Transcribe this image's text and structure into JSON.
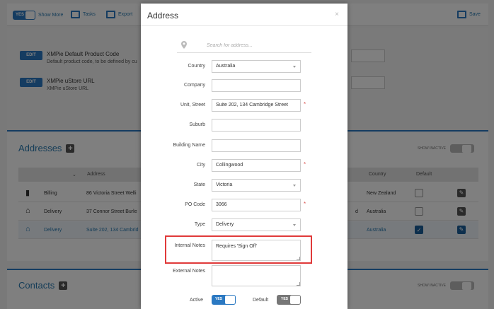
{
  "background": {
    "toolbar": {
      "show_more_toggle": "YES",
      "show_more_label": "Show More",
      "tasks_label": "Tasks",
      "export_label": "Export",
      "save_label": "Save"
    },
    "settings": [
      {
        "edit_label": "EDIT",
        "title": "XMPie Default Product Code",
        "sub": "Default product code, to be defined by cu"
      },
      {
        "edit_label": "EDIT",
        "title": "XMPie uStore URL",
        "sub": "XMPie uStore URL"
      }
    ],
    "addresses": {
      "title": "Addresses",
      "show_inactive": "SHOW INACTIVE",
      "toggle": "NO",
      "headers": {
        "address": "Address",
        "country": "Country",
        "default": "Default"
      },
      "rows": [
        {
          "type": "Billing",
          "address": "86 Victoria Street Welli",
          "extra": "",
          "country": "New Zealand",
          "default": false,
          "icon": "building-icon"
        },
        {
          "type": "Delivery",
          "address": "37 Connor Street Burle",
          "extra": "d",
          "country": "Australia",
          "default": false,
          "icon": "home-icon"
        },
        {
          "type": "Delivery",
          "address": "Suite 202, 134 Cambrid",
          "extra": "",
          "country": "Australia",
          "default": true,
          "icon": "home-icon"
        }
      ]
    },
    "contacts": {
      "title": "Contacts",
      "show_inactive": "SHOW INACTIVE",
      "toggle": "NO"
    }
  },
  "modal": {
    "title": "Address",
    "close": "×",
    "search_placeholder": "Search for address...",
    "fields": {
      "country": {
        "label": "Country",
        "value": "Australia"
      },
      "company": {
        "label": "Company",
        "value": ""
      },
      "unit_street": {
        "label": "Unit, Street",
        "value": "Suite 202, 134 Cambridge Street"
      },
      "suburb": {
        "label": "Suburb",
        "value": ""
      },
      "building_name": {
        "label": "Building Name",
        "value": ""
      },
      "city": {
        "label": "City",
        "value": "Collingwood"
      },
      "state": {
        "label": "State",
        "value": "Victoria"
      },
      "po_code": {
        "label": "PO Code",
        "value": "3066"
      },
      "type": {
        "label": "Type",
        "value": "Delivery"
      },
      "internal_notes": {
        "label": "Internal Notes",
        "value": "Requires 'Sign Off'"
      },
      "external_notes": {
        "label": "External Notes",
        "value": ""
      }
    },
    "required_mark": "*",
    "active": {
      "label": "Active",
      "value": "YES"
    },
    "default": {
      "label": "Default",
      "value": "YES"
    },
    "colors": {
      "accent": "#2b79c2",
      "highlight": "#e03a3a",
      "required": "#d9534f",
      "toggle_off": "#777777"
    }
  }
}
